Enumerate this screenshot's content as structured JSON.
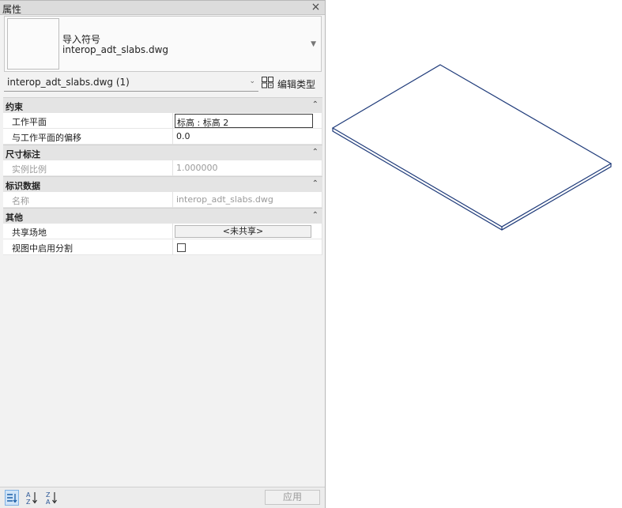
{
  "palette": {
    "title": "属性",
    "close_icon": "×"
  },
  "type_selector": {
    "family": "导入符号",
    "type_name": "interop_adt_slabs.dwg"
  },
  "instance": {
    "filter_text": "interop_adt_slabs.dwg (1)",
    "edit_type_label": "编辑类型"
  },
  "sections": [
    {
      "label": "约束",
      "params": [
        {
          "name": "工作平面",
          "value": "标高 : 标高 2",
          "kind": "editbox",
          "enabled": true
        },
        {
          "name": "与工作平面的偏移",
          "value": "0.0",
          "kind": "text",
          "enabled": true
        }
      ]
    },
    {
      "label": "尺寸标注",
      "params": [
        {
          "name": "实例比例",
          "value": "1.000000",
          "kind": "text",
          "enabled": false
        }
      ]
    },
    {
      "label": "标识数据",
      "params": [
        {
          "name": "名称",
          "value": "interop_adt_slabs.dwg",
          "kind": "text",
          "enabled": false
        }
      ]
    },
    {
      "label": "其他",
      "params": [
        {
          "name": "共享场地",
          "value": "<未共享>",
          "kind": "button",
          "enabled": true
        },
        {
          "name": "视图中启用分割",
          "value": "",
          "kind": "checkbox",
          "checked": false,
          "enabled": true
        }
      ]
    }
  ],
  "footer": {
    "apply_label": "应用",
    "sort_buttons": [
      "categorized-sort-icon",
      "sort-az-icon",
      "sort-za-icon"
    ]
  },
  "viewport": {
    "outline_color": "#1f3b7a"
  }
}
